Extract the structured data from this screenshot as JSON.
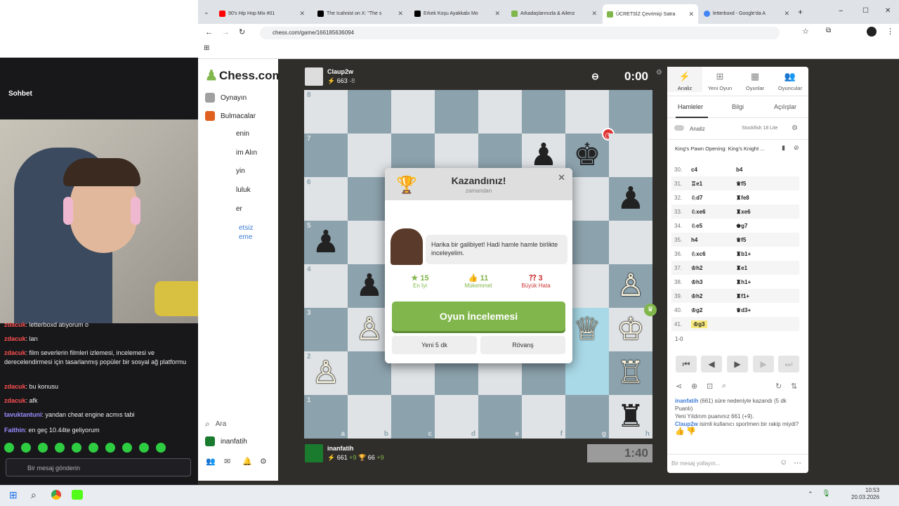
{
  "stream": {
    "chat_title": "Sohbet",
    "chat_lines": [
      {
        "user": "zdacuk",
        "text": ": letterboxd atıyorum o"
      },
      {
        "user": "zdacuk",
        "text": ": ları"
      },
      {
        "user": "zdacuk",
        "text": ": film severlerin filmleri izlemesi, incelemesi ve derecelendirmesi için tasarlanmış popüler bir sosyal ağ platformu"
      },
      {
        "user": "zdacuk",
        "text": ": bu konusu"
      },
      {
        "user": "zdacuk",
        "text": ": afk"
      },
      {
        "user": "tavuktantuni",
        "text": ": yandan cheat engine acmıs tabi"
      },
      {
        "user": "Faithin",
        "text": ": en geç 10.44te geliyorum"
      }
    ],
    "chat_placeholder": "Bir mesaj gönderin"
  },
  "browser": {
    "tabs": [
      {
        "label": "90's Hip Hop Mix #01",
        "color": "#ff0000"
      },
      {
        "label": "The Icahnist on X: \"The s",
        "color": "#000000"
      },
      {
        "label": "Erkek Koşu Ayakkabı Mo",
        "color": "#000000"
      },
      {
        "label": "Arkadaşlarınızla & Ailenz",
        "color": "#81b64c"
      },
      {
        "label": "ÜCRETSİZ Çevrimiçi Satra",
        "color": "#81b64c"
      },
      {
        "label": "letterboxd - Google'da A",
        "color": "#4285f4"
      }
    ],
    "url": "chess.com/game/166185636094"
  },
  "site": {
    "logo": "Chess.com",
    "nav": [
      {
        "label": "Oynayın",
        "color": "#a0a0a0"
      },
      {
        "label": "Bulmacalar",
        "color": "#e06020"
      },
      {
        "label": "enin",
        "color": "#f0b040"
      },
      {
        "label": "im Alın",
        "color": "#5aa0e0"
      },
      {
        "label": "yin",
        "color": "#e85050"
      },
      {
        "label": "luluk",
        "color": "#8080c0"
      },
      {
        "label": "er",
        "color": "#999999"
      },
      {
        "label": "etsiz",
        "color": "#3d7bd6"
      },
      {
        "label": "eme",
        "color": "#3d7bd6"
      }
    ],
    "search": "Ara",
    "user": "inanfatih"
  },
  "game": {
    "top_player": {
      "name": "Claup2w",
      "rating": "663",
      "delta": "-8",
      "clock": "0:00"
    },
    "bottom_player": {
      "name": "inanfatih",
      "rating": "661",
      "delta": "+9",
      "extra": "66",
      "extra_delta": "+9",
      "clock": "1:40"
    },
    "ranks": [
      "8",
      "7",
      "6",
      "5",
      "4",
      "3",
      "2",
      "1"
    ],
    "files": [
      "a",
      "b",
      "c",
      "d",
      "e",
      "f",
      "g",
      "h"
    ]
  },
  "modal": {
    "title": "Kazandınız!",
    "subtitle": "zamandan",
    "coach_message": "Harika bir galibiyet! Hadi hamle hamle birlikte inceleyelim.",
    "stats": [
      {
        "value": "15",
        "label": "En İyi",
        "color": "#81b64c"
      },
      {
        "value": "11",
        "label": "Mükemmel",
        "color": "#81b64c"
      },
      {
        "value": "3",
        "label": "Büyük Hata",
        "color": "#cc3333"
      }
    ],
    "review_button": "Oyun İncelemesi",
    "new_game_button": "Yeni 5 dk",
    "rematch_button": "Rövanş"
  },
  "panel": {
    "tabs": [
      "Analiz",
      "Yeni Oyun",
      "Oyunlar",
      "Oyuncular"
    ],
    "subtabs": [
      "Hamleler",
      "Bilgi",
      "Açılışlar"
    ],
    "analysis_label": "Analiz",
    "engine": "Stockfish 18 Lite",
    "opening": "King's Pawn Opening: King's Knight ...",
    "moves": [
      {
        "n": "30.",
        "w": "c4",
        "b": "b4"
      },
      {
        "n": "31.",
        "w": "♖e1",
        "b": "♛f5"
      },
      {
        "n": "32.",
        "w": "♘d7",
        "b": "♜fe8"
      },
      {
        "n": "33.",
        "w": "♘xe6",
        "b": "♜xe6"
      },
      {
        "n": "34.",
        "w": "♘e5",
        "b": "♚g7"
      },
      {
        "n": "35.",
        "w": "h4",
        "b": "♛f5"
      },
      {
        "n": "36.",
        "w": "♘xc6",
        "b": "♜b1+"
      },
      {
        "n": "37.",
        "w": "♔h2",
        "b": "♜e1"
      },
      {
        "n": "38.",
        "w": "♔h3",
        "b": "♜h1+"
      },
      {
        "n": "39.",
        "w": "♔h2",
        "b": "♜f1+"
      },
      {
        "n": "40.",
        "w": "♔g2",
        "b": "♛d3+"
      },
      {
        "n": "41.",
        "w": "♔g3",
        "b": ""
      }
    ],
    "result": "1-0",
    "chat_log_1_user": "inanfatih",
    "chat_log_1_text": "(661) süre nedeniyle kazandı (5 dk Puanlı)",
    "chat_log_2": "Yeni Yıldırım puanınız 661 (+9).",
    "chat_log_3_user": "Claup2w",
    "chat_log_3_text": "isimli kullanıcı sportmen bir rakip miydi?",
    "chat_placeholder": "Bir mesaj yollayın..."
  },
  "taskbar": {
    "time": "10:53",
    "date": "20.03.2026"
  }
}
